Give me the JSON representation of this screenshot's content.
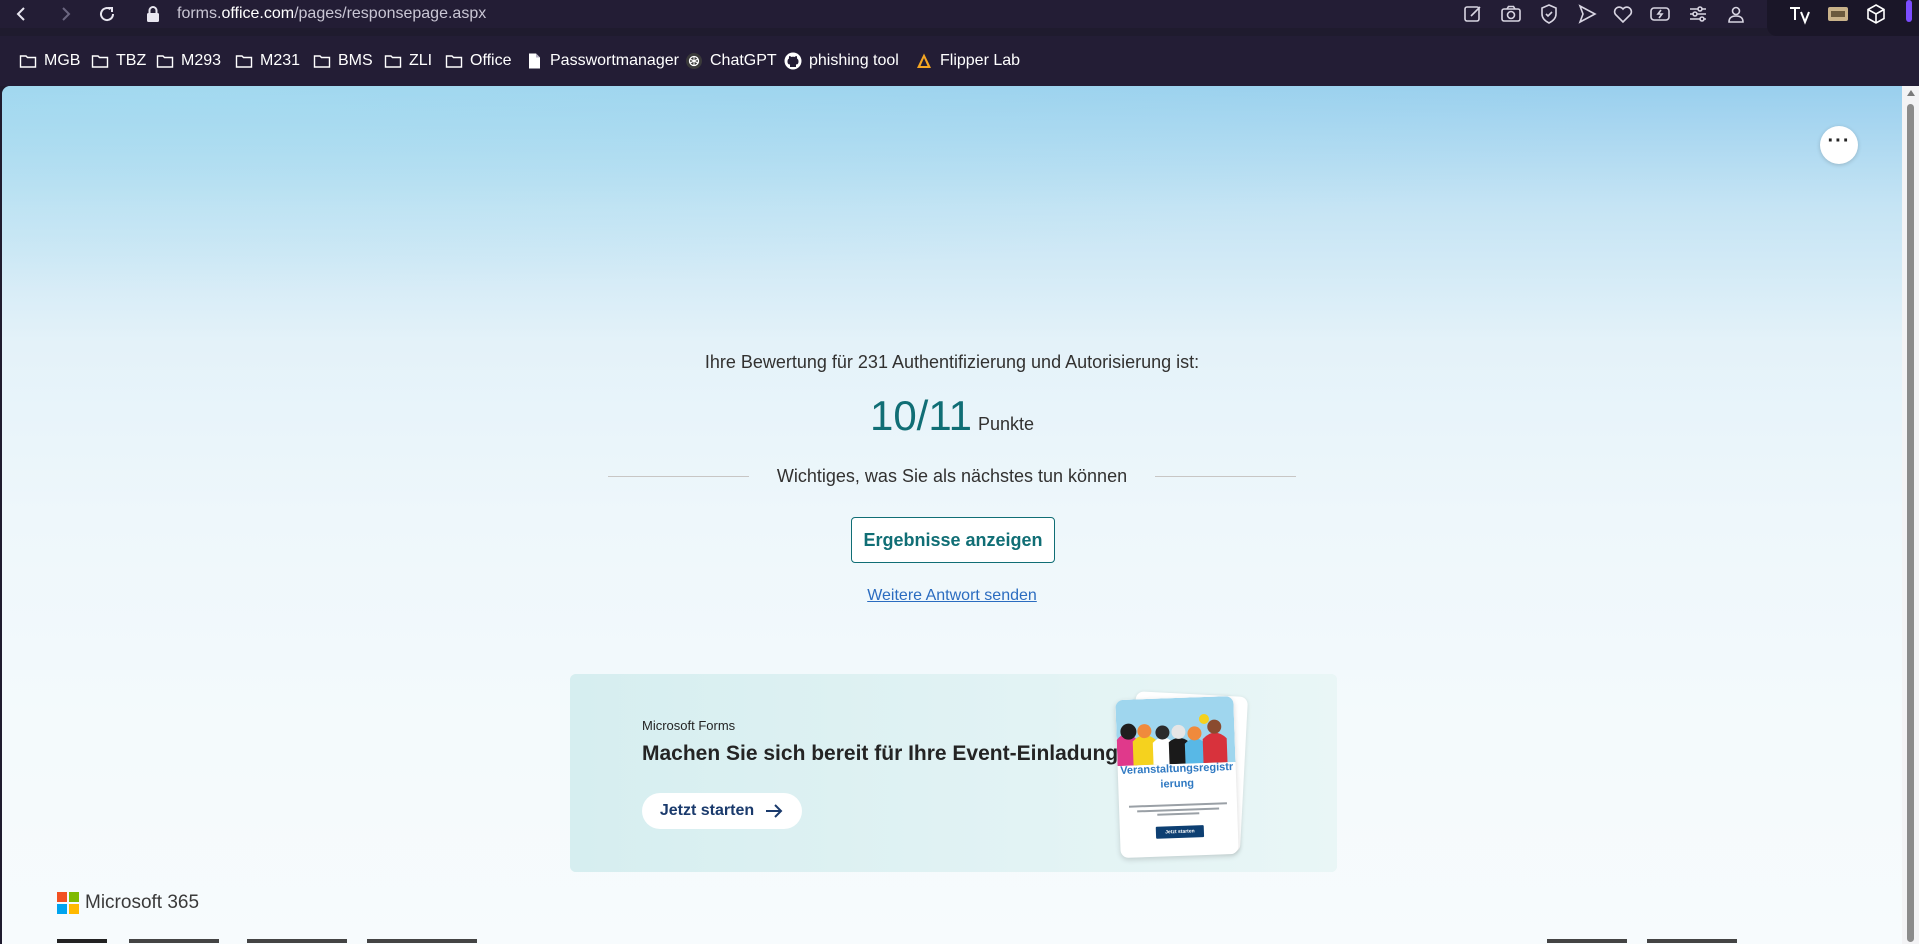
{
  "browser": {
    "url_prefix": "forms.",
    "url_domain": "office.com",
    "url_path": "/pages/responsepage.aspx",
    "bookmarks": [
      {
        "label": "MGB",
        "icon": "folder-icon"
      },
      {
        "label": "TBZ",
        "icon": "folder-icon"
      },
      {
        "label": "M293",
        "icon": "folder-icon"
      },
      {
        "label": "M231",
        "icon": "folder-icon"
      },
      {
        "label": "BMS",
        "icon": "folder-icon"
      },
      {
        "label": "ZLI",
        "icon": "folder-icon"
      },
      {
        "label": "Office",
        "icon": "folder-icon"
      },
      {
        "label": "Passwortmanager",
        "icon": "document-icon"
      },
      {
        "label": "ChatGPT",
        "icon": "chatgpt-icon"
      },
      {
        "label": "phishing tool",
        "icon": "github-icon"
      },
      {
        "label": "Flipper Lab",
        "icon": "flipper-icon"
      }
    ]
  },
  "page": {
    "more_button": "···",
    "score_caption": "Ihre Bewertung für 231 Authentifizierung und Autorisierung ist:",
    "score_value": "10/11",
    "score_unit": "Punkte",
    "next_steps_heading": "Wichtiges, was Sie als nächstes tun können",
    "results_button": "Ergebnisse anzeigen",
    "another_response_link": "Weitere Antwort senden",
    "promo": {
      "brand": "Microsoft Forms",
      "title": "Machen Sie sich bereit für Ihre Event-Einladung!",
      "button": "Jetzt starten",
      "card_title": "Veranstaltungsregistr ierung",
      "card_button": "Jetzt starten"
    },
    "footer_brand": "Microsoft 365"
  },
  "colors": {
    "accent": "#106e75",
    "link": "#2b6cc0",
    "chrome": "#231d35"
  }
}
